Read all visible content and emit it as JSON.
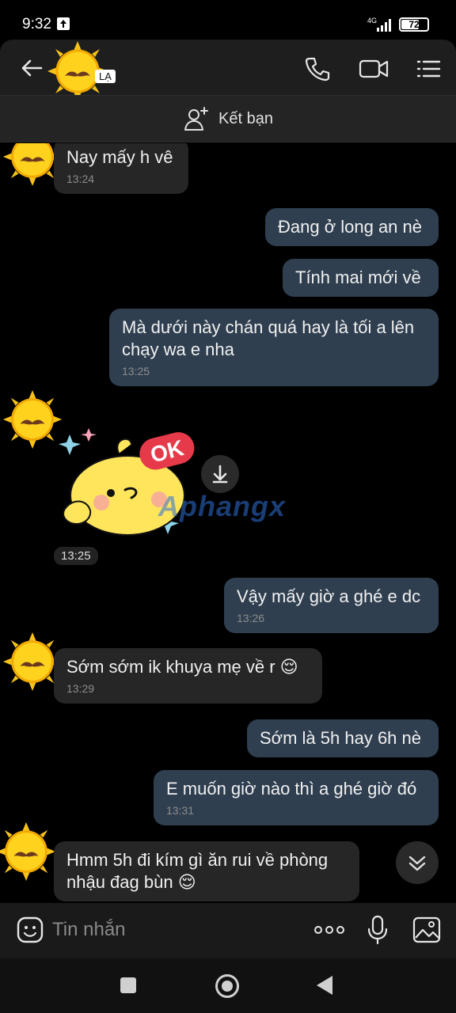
{
  "status_bar": {
    "time": "9:32",
    "network": "4G",
    "battery": "72",
    "battery_level": 0.72
  },
  "header": {
    "badge": "LẠ"
  },
  "add_friend": {
    "label": "Kết bạn"
  },
  "messages": [
    {
      "dir": "in",
      "text": "Nay mấy h vê",
      "time": "13:24"
    },
    {
      "dir": "out",
      "text": "Đang ở long an nè",
      "time": ""
    },
    {
      "dir": "out",
      "text": "Tính mai mới về",
      "time": ""
    },
    {
      "dir": "out",
      "text": "Mà dưới này chán quá hay là tối a lên chạy wa e nha",
      "time": "13:25"
    },
    {
      "dir": "in",
      "type": "sticker",
      "sticker": "ok-chick-sticker",
      "time": "13:25"
    },
    {
      "dir": "out",
      "text": "Vậy mấy giờ a ghé e dc",
      "time": "13:26"
    },
    {
      "dir": "in",
      "text": "Sớm sớm ik khuya mẹ về r 😌",
      "time": "13:29"
    },
    {
      "dir": "out",
      "text": "Sớm là 5h hay 6h nè",
      "time": ""
    },
    {
      "dir": "out",
      "text": "E muốn giờ nào thì a ghé giờ đó",
      "time": "13:31"
    },
    {
      "dir": "in",
      "text": "Hmm 5h đi kím gì ăn rui về phòng nhậu đag bùn 😌",
      "time": ""
    }
  ],
  "sticker_text": "OK",
  "watermark": "Aphangx",
  "input": {
    "placeholder": "Tin nhắn",
    "value": ""
  },
  "colors": {
    "incoming_bubble": "#262626",
    "outgoing_bubble": "#2f3f50",
    "background": "#000000"
  }
}
